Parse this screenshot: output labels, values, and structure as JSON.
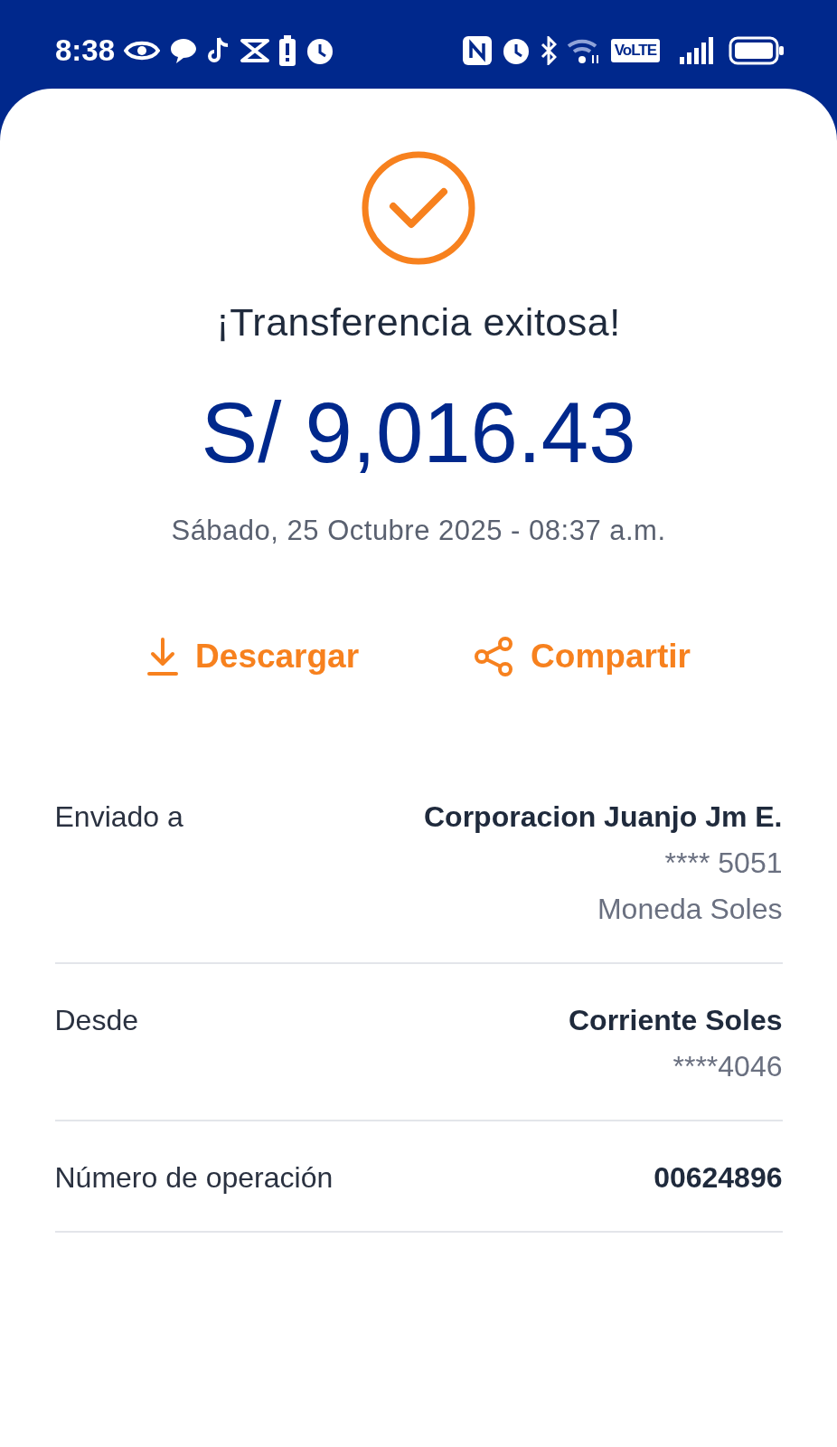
{
  "status_bar": {
    "time": "8:38",
    "network_badge": "VoLTE"
  },
  "receipt": {
    "title": "¡Transferencia exitosa!",
    "amount": "S/ 9,016.43",
    "date": "Sábado, 25 Octubre 2025 - 08:37 a.m.",
    "actions": [
      {
        "kind": "download",
        "label": "Descargar"
      },
      {
        "kind": "share",
        "label": "Compartir"
      }
    ],
    "details": [
      {
        "label": "Enviado a",
        "lines": [
          "Corporacion Juanjo Jm E.",
          "**** 5051",
          "Moneda Soles"
        ]
      },
      {
        "label": "Desde",
        "lines": [
          "Corriente Soles",
          "****4046"
        ]
      },
      {
        "label": "Número de operación",
        "lines": [
          "00624896"
        ]
      }
    ]
  }
}
